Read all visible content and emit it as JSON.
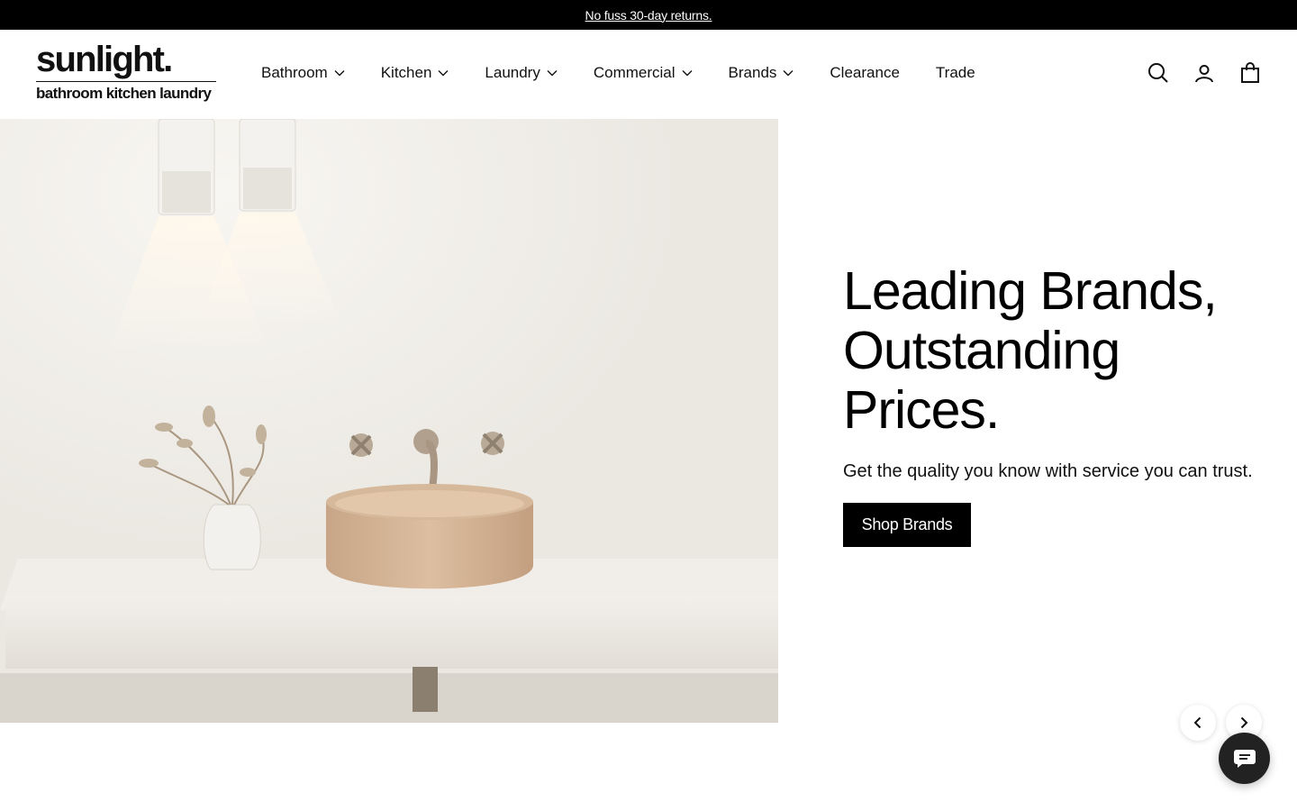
{
  "announcement": {
    "text": "No fuss 30-day returns."
  },
  "logo": {
    "main": "sunlight.",
    "sub": "bathroom kitchen laundry"
  },
  "nav": {
    "items": [
      {
        "label": "Bathroom",
        "has_dropdown": true
      },
      {
        "label": "Kitchen",
        "has_dropdown": true
      },
      {
        "label": "Laundry",
        "has_dropdown": true
      },
      {
        "label": "Commercial",
        "has_dropdown": true
      },
      {
        "label": "Brands",
        "has_dropdown": true
      },
      {
        "label": "Clearance",
        "has_dropdown": false
      },
      {
        "label": "Trade",
        "has_dropdown": false
      }
    ]
  },
  "header_icons": [
    "search-icon",
    "account-icon",
    "cart-icon"
  ],
  "hero": {
    "title_lines": [
      "Leading Brands,",
      "Outstanding",
      "Prices."
    ],
    "subtitle": "Get the quality you know with service you can trust.",
    "cta_label": "Shop Brands"
  },
  "colors": {
    "announcement_bg": "#000000",
    "cta_bg": "#000000",
    "chat_bg": "#222222"
  }
}
